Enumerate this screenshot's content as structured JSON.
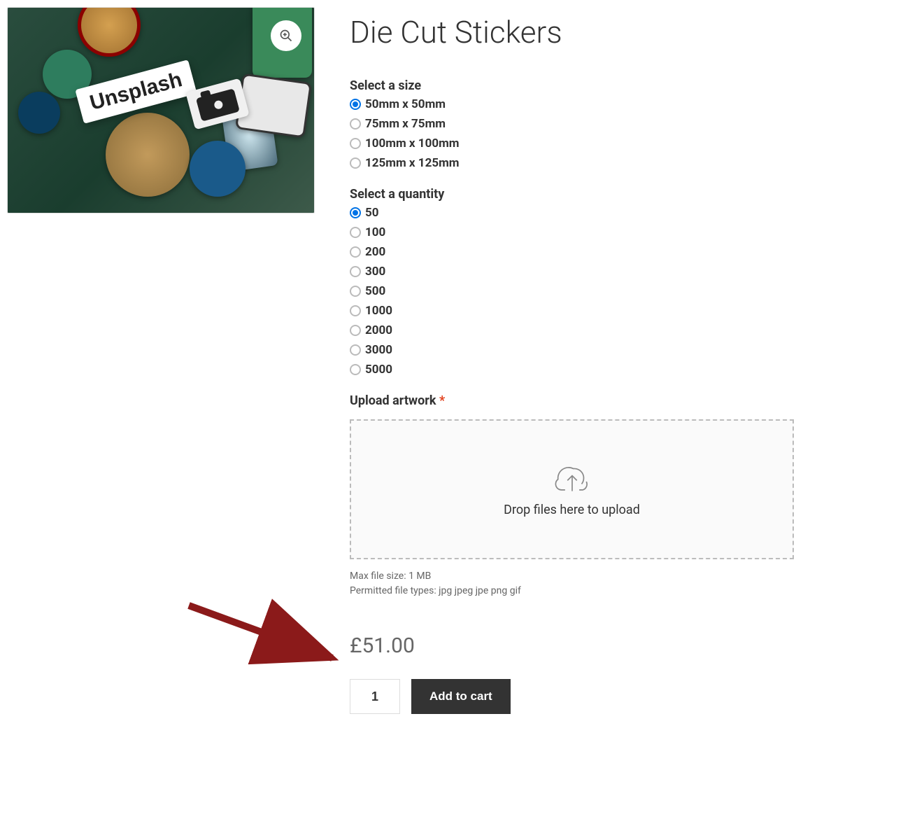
{
  "product": {
    "title": "Die Cut Stickers",
    "image_label": "Unsplash"
  },
  "size": {
    "label": "Select a size",
    "options": [
      "50mm x 50mm",
      "75mm x 75mm",
      "100mm x 100mm",
      "125mm x 125mm"
    ],
    "selected": "50mm x 50mm"
  },
  "quantity": {
    "label": "Select a quantity",
    "options": [
      "50",
      "100",
      "200",
      "300",
      "500",
      "1000",
      "2000",
      "3000",
      "5000"
    ],
    "selected": "50"
  },
  "upload": {
    "label": "Upload artwork",
    "required_mark": "*",
    "drop_text": "Drop files here to upload",
    "max_size_text": "Max file size: 1 MB",
    "permitted_text": "Permitted file types: jpg jpeg jpe png gif"
  },
  "price": {
    "display": "£51.00"
  },
  "cart": {
    "qty_value": "1",
    "button_label": "Add to cart"
  },
  "icons": {
    "zoom": "magnify-plus-icon",
    "cloud": "cloud-upload-icon"
  }
}
